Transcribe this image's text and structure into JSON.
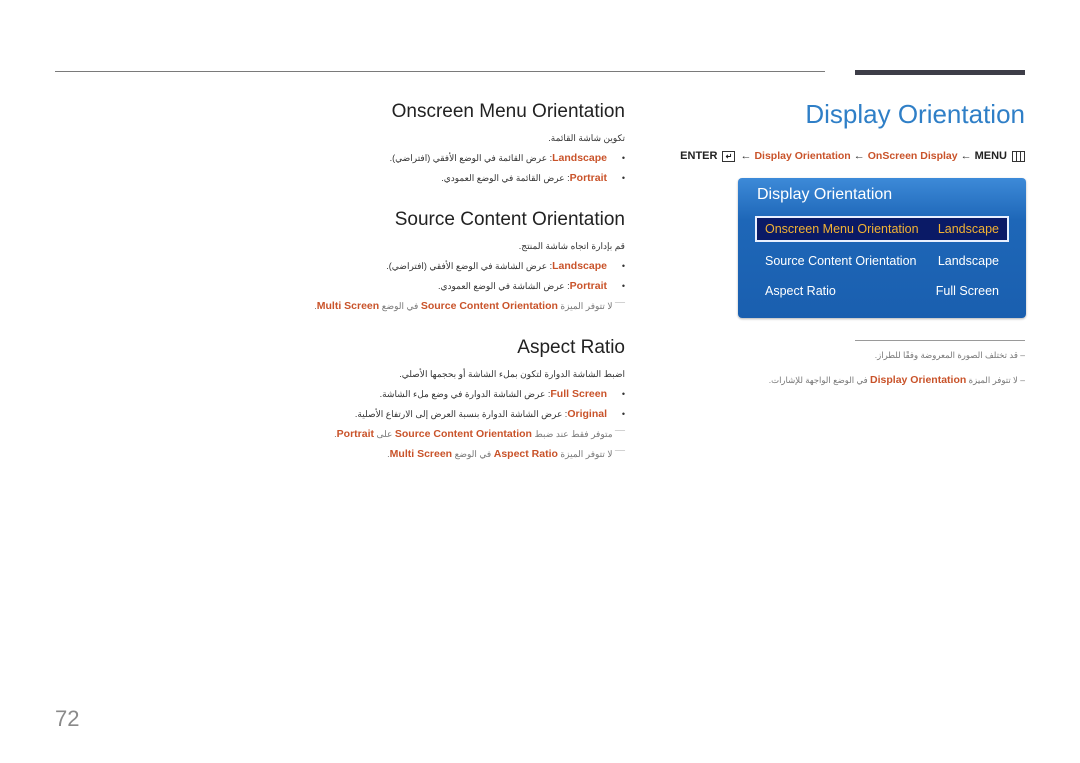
{
  "page": {
    "title": "Display Orientation",
    "page_number": "72"
  },
  "breadcrumb": {
    "enter": "ENTER",
    "arrow": "←",
    "item1": "Display Orientation",
    "item2": "OnScreen Display",
    "menu": "MENU"
  },
  "osd": {
    "title": "Display Orientation",
    "rows": [
      {
        "label": "Onscreen Menu Orientation",
        "value": "Landscape",
        "selected": true
      },
      {
        "label": "Source Content Orientation",
        "value": "Landscape",
        "selected": false
      },
      {
        "label": "Aspect Ratio",
        "value": "Full Screen",
        "selected": false
      }
    ]
  },
  "notes": [
    {
      "pre": "",
      "hl": "",
      "post": "قد تختلف الصورة المعروضة وفقًا للطراز."
    },
    {
      "pre": "لا تتوفر الميزة ",
      "hl": "Display Orientation",
      "post": " في الوضع الواجهة للإشارات."
    }
  ],
  "sections": [
    {
      "title": "Onscreen Menu Orientation",
      "desc": "تكوين شاشة القائمة.",
      "bullets": [
        {
          "term": "Landscape",
          "text": ": عرض القائمة في الوضع الأفقي (افتراضي)."
        },
        {
          "term": "Portrait",
          "text": ": عرض القائمة في الوضع العمودي."
        }
      ],
      "footnotes": []
    },
    {
      "title": "Source Content Orientation",
      "desc": "قم بإدارة اتجاه شاشة المنتج.",
      "bullets": [
        {
          "term": "Landscape",
          "text": ": عرض الشاشة في الوضع الأفقي (افتراضي)."
        },
        {
          "term": "Portrait",
          "text": ": عرض الشاشة في الوضع العمودي."
        }
      ],
      "footnotes": [
        {
          "pre": "لا تتوفر الميزة ",
          "hl1": "Source Content Orientation",
          "mid": " في الوضع ",
          "hl2": "Multi Screen",
          "post": "."
        }
      ]
    },
    {
      "title": "Aspect Ratio",
      "desc": "اضبط الشاشة الدوارة لتكون بملء الشاشة أو بحجمها الأصلي.",
      "bullets": [
        {
          "term": "Full Screen",
          "text": ": عرض الشاشة الدوارة في وضع ملء الشاشة."
        },
        {
          "term": "Original",
          "text": ": عرض الشاشة الدوارة بنسبة العرض إلى الارتفاع الأصلية."
        }
      ],
      "footnotes": [
        {
          "pre": "متوفر فقط عند ضبط ",
          "hl1": "Source Content Orientation",
          "mid": " على ",
          "hl2": "Portrait",
          "post": "."
        },
        {
          "pre": "لا تتوفر الميزة ",
          "hl1": "Aspect Ratio",
          "mid": " في الوضع ",
          "hl2": "Multi Screen",
          "post": "."
        }
      ]
    }
  ]
}
